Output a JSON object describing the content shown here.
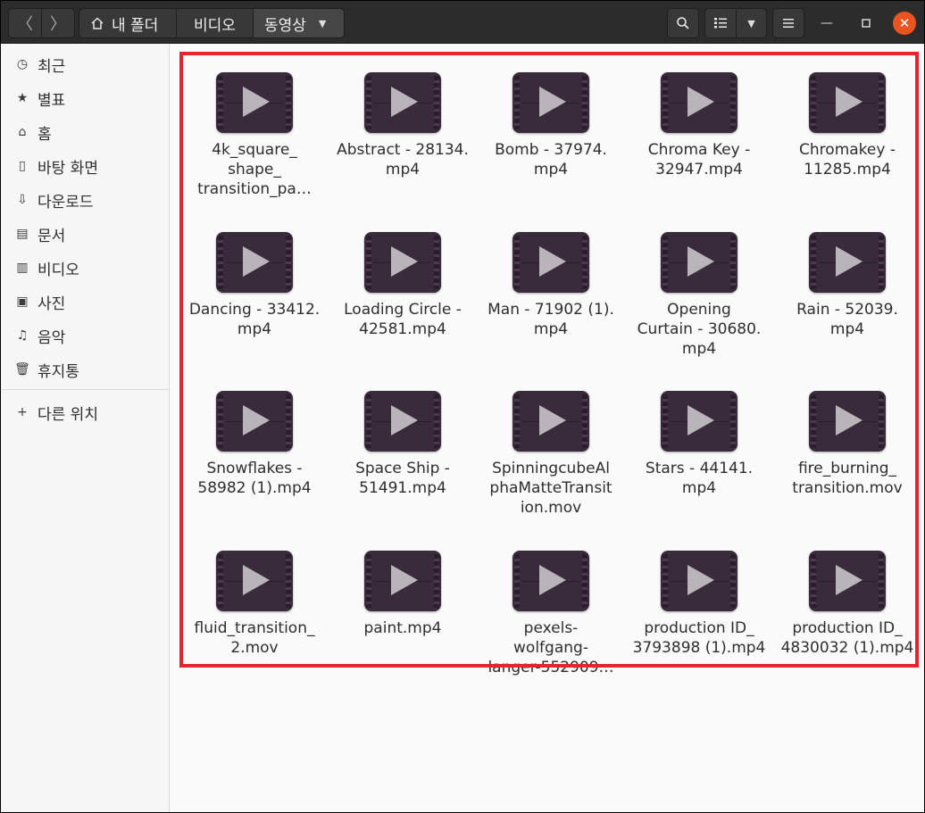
{
  "header": {
    "back_icon": "chevron-left-icon",
    "forward_icon": "chevron-right-icon",
    "breadcrumb": [
      "내 폴더",
      "비디오",
      "동영상"
    ],
    "search_icon": "search-icon",
    "view_icon": "list-view-icon",
    "menu_icon": "hamburger-menu-icon"
  },
  "sidebar": {
    "items": [
      {
        "icon": "recent-icon",
        "label": "최근"
      },
      {
        "icon": "star-icon",
        "label": "별표"
      },
      {
        "icon": "home-icon",
        "label": "홈"
      },
      {
        "icon": "desktop-icon",
        "label": "바탕 화면"
      },
      {
        "icon": "download-icon",
        "label": "다운로드"
      },
      {
        "icon": "document-icon",
        "label": "문서"
      },
      {
        "icon": "video-icon",
        "label": "비디오"
      },
      {
        "icon": "image-icon",
        "label": "사진"
      },
      {
        "icon": "music-icon",
        "label": "음악"
      },
      {
        "icon": "trash-icon",
        "label": "휴지통"
      }
    ],
    "other_locations": {
      "icon": "plus-icon",
      "label": "다른 위치"
    }
  },
  "files": [
    {
      "lines": [
        "4k_square_",
        "shape_",
        "transition_pa…"
      ]
    },
    {
      "lines": [
        "Abstract - 28134.",
        "mp4"
      ]
    },
    {
      "lines": [
        "Bomb - 37974.",
        "mp4"
      ]
    },
    {
      "lines": [
        "Chroma Key -",
        "32947.mp4"
      ]
    },
    {
      "lines": [
        "Chromakey -",
        "11285.mp4"
      ]
    },
    {
      "lines": [
        "Dancing - 33412.",
        "mp4"
      ]
    },
    {
      "lines": [
        "Loading Circle -",
        "42581.mp4"
      ]
    },
    {
      "lines": [
        "Man - 71902 (1).",
        "mp4"
      ]
    },
    {
      "lines": [
        "Opening",
        "Curtain - 30680.",
        "mp4"
      ]
    },
    {
      "lines": [
        "Rain - 52039.",
        "mp4"
      ]
    },
    {
      "lines": [
        "Snowflakes -",
        "58982 (1).mp4"
      ]
    },
    {
      "lines": [
        "Space Ship -",
        "51491.mp4"
      ]
    },
    {
      "lines": [
        "SpinningcubeAl",
        "phaMatteTransit",
        "ion.mov"
      ]
    },
    {
      "lines": [
        "Stars - 44141.",
        "mp4"
      ]
    },
    {
      "lines": [
        "fire_burning_",
        "transition.mov"
      ]
    },
    {
      "lines": [
        "fluid_transition_",
        "2.mov"
      ]
    },
    {
      "lines": [
        "paint.mp4"
      ]
    },
    {
      "lines": [
        "pexels-",
        "wolfgang-",
        "langer-552909…"
      ]
    },
    {
      "lines": [
        "production ID_",
        "3793898 (1).mp4"
      ]
    },
    {
      "lines": [
        "production ID_",
        "4830032 (1).mp4"
      ]
    }
  ]
}
